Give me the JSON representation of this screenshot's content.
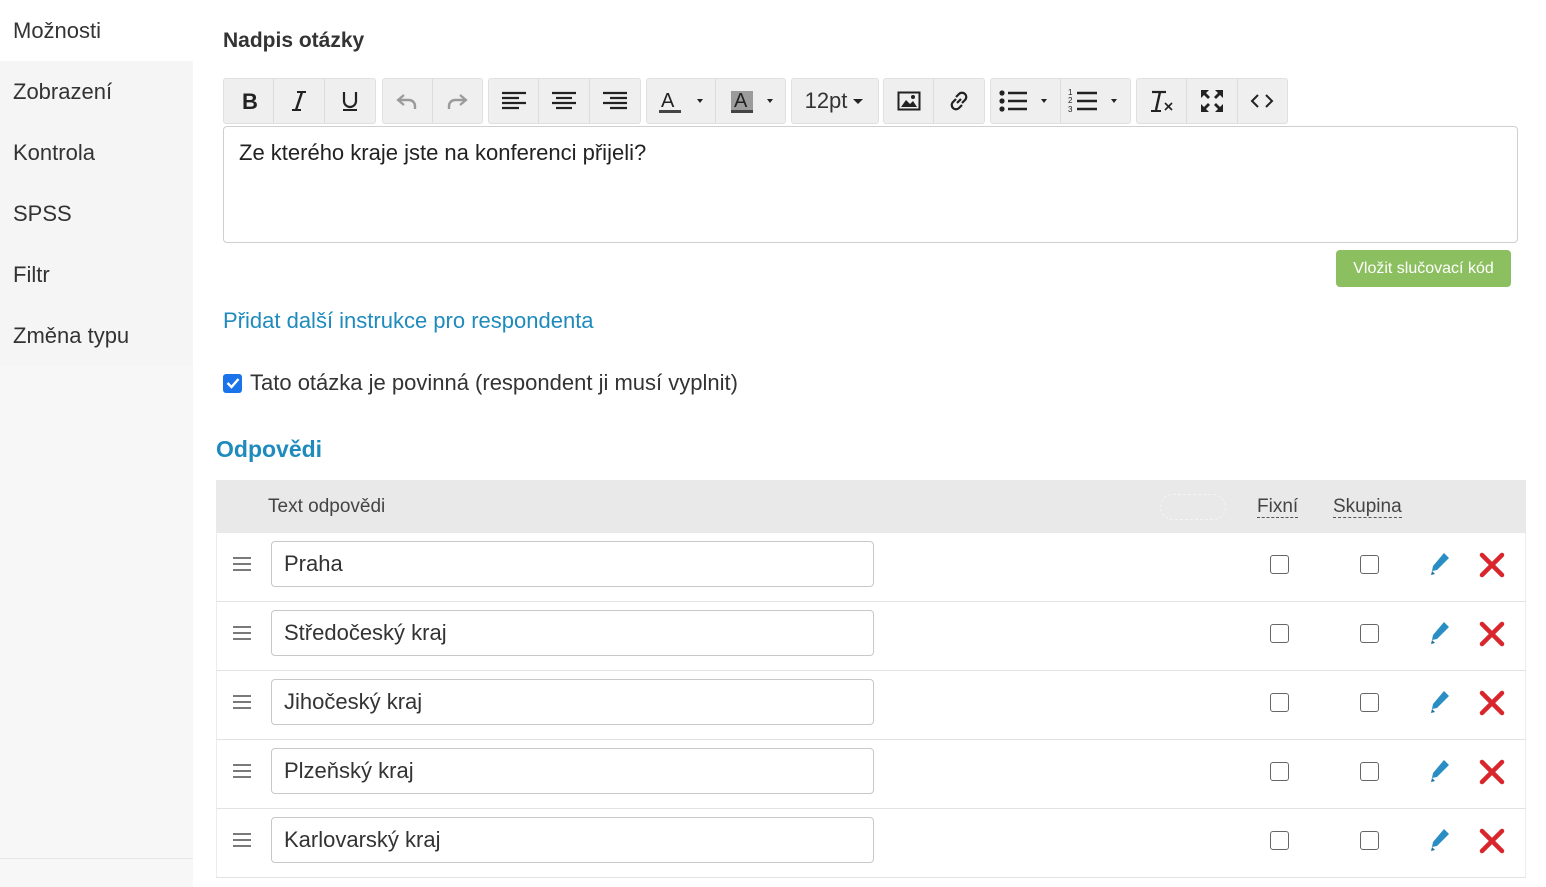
{
  "sidebar": {
    "items": [
      {
        "label": "Možnosti",
        "active": true
      },
      {
        "label": "Zobrazení",
        "active": false
      },
      {
        "label": "Kontrola",
        "active": false
      },
      {
        "label": "SPSS",
        "active": false
      },
      {
        "label": "Filtr",
        "active": false
      },
      {
        "label": "Změna typu",
        "active": false
      }
    ]
  },
  "question": {
    "label": "Nadpis otázky",
    "text": "Ze kterého kraje jste na konferenci přijeli?"
  },
  "toolbar": {
    "font_size": "12pt",
    "icons": [
      "bold-icon",
      "italic-icon",
      "underline-icon",
      "undo-icon",
      "redo-icon",
      "align-left-icon",
      "align-center-icon",
      "align-right-icon",
      "text-color-icon",
      "background-color-icon",
      "image-icon",
      "link-icon",
      "bullet-list-icon",
      "numbered-list-icon",
      "clear-format-icon",
      "fullscreen-icon",
      "source-code-icon"
    ]
  },
  "merge_button": "Vložit slučovací kód",
  "instructions_link": "Přidat další instrukce pro respondenta",
  "required": {
    "label": "Tato otázka je povinná (respondent ji musí vyplnit)",
    "checked": true
  },
  "answers": {
    "title": "Odpovědi",
    "headers": {
      "text": "Text odpovědi",
      "fixed": "Fixní",
      "group": "Skupina"
    },
    "rows": [
      {
        "text": "Praha",
        "fixed": false,
        "group": false
      },
      {
        "text": "Středočeský kraj",
        "fixed": false,
        "group": false
      },
      {
        "text": "Jihočeský kraj",
        "fixed": false,
        "group": false
      },
      {
        "text": "Plzeňský kraj",
        "fixed": false,
        "group": false
      },
      {
        "text": "Karlovarský kraj",
        "fixed": false,
        "group": false
      }
    ]
  },
  "colors": {
    "link": "#1f8bbd",
    "merge_button": "#8cbf5f",
    "delete": "#d9262c",
    "edit": "#2a8ec4"
  }
}
